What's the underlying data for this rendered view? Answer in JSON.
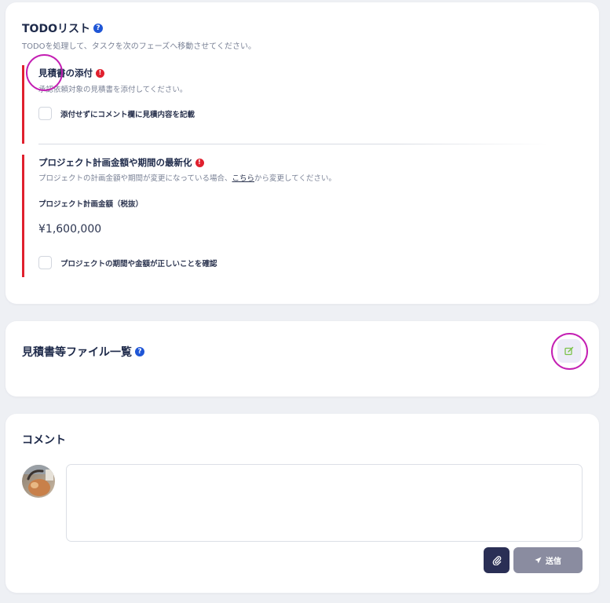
{
  "todo": {
    "title": "TODOリスト",
    "subtitle": "TODOを処理して、タスクを次のフェーズへ移動させてください。",
    "tasks": [
      {
        "title": "見積書の添付",
        "description": "承認依頼対象の見積書を添付してください。",
        "checkbox_label": "添付せずにコメント欄に見積内容を記載"
      },
      {
        "title": "プロジェクト計画金額や期間の最新化",
        "description_before": "プロジェクトの計画金額や期間が変更になっている場合、",
        "description_link": "こちら",
        "description_after": "から変更してください。",
        "field_label": "プロジェクト計画金額（税抜）",
        "amount": "¥1,600,000",
        "checkbox_label": "プロジェクトの期間や金額が正しいことを確認"
      }
    ]
  },
  "files": {
    "title": "見積書等ファイル一覧"
  },
  "comment": {
    "title": "コメント",
    "input_value": "",
    "send_label": "送信"
  },
  "icons": {
    "help": "?",
    "alert": "!"
  },
  "colors": {
    "accent_red": "#e0202e",
    "help_blue": "#1f56d6",
    "highlight_magenta": "#c41fb3",
    "edit_green": "#7cc24a",
    "attach_navy": "#2a2f55",
    "send_disabled": "#8a8ca0"
  }
}
